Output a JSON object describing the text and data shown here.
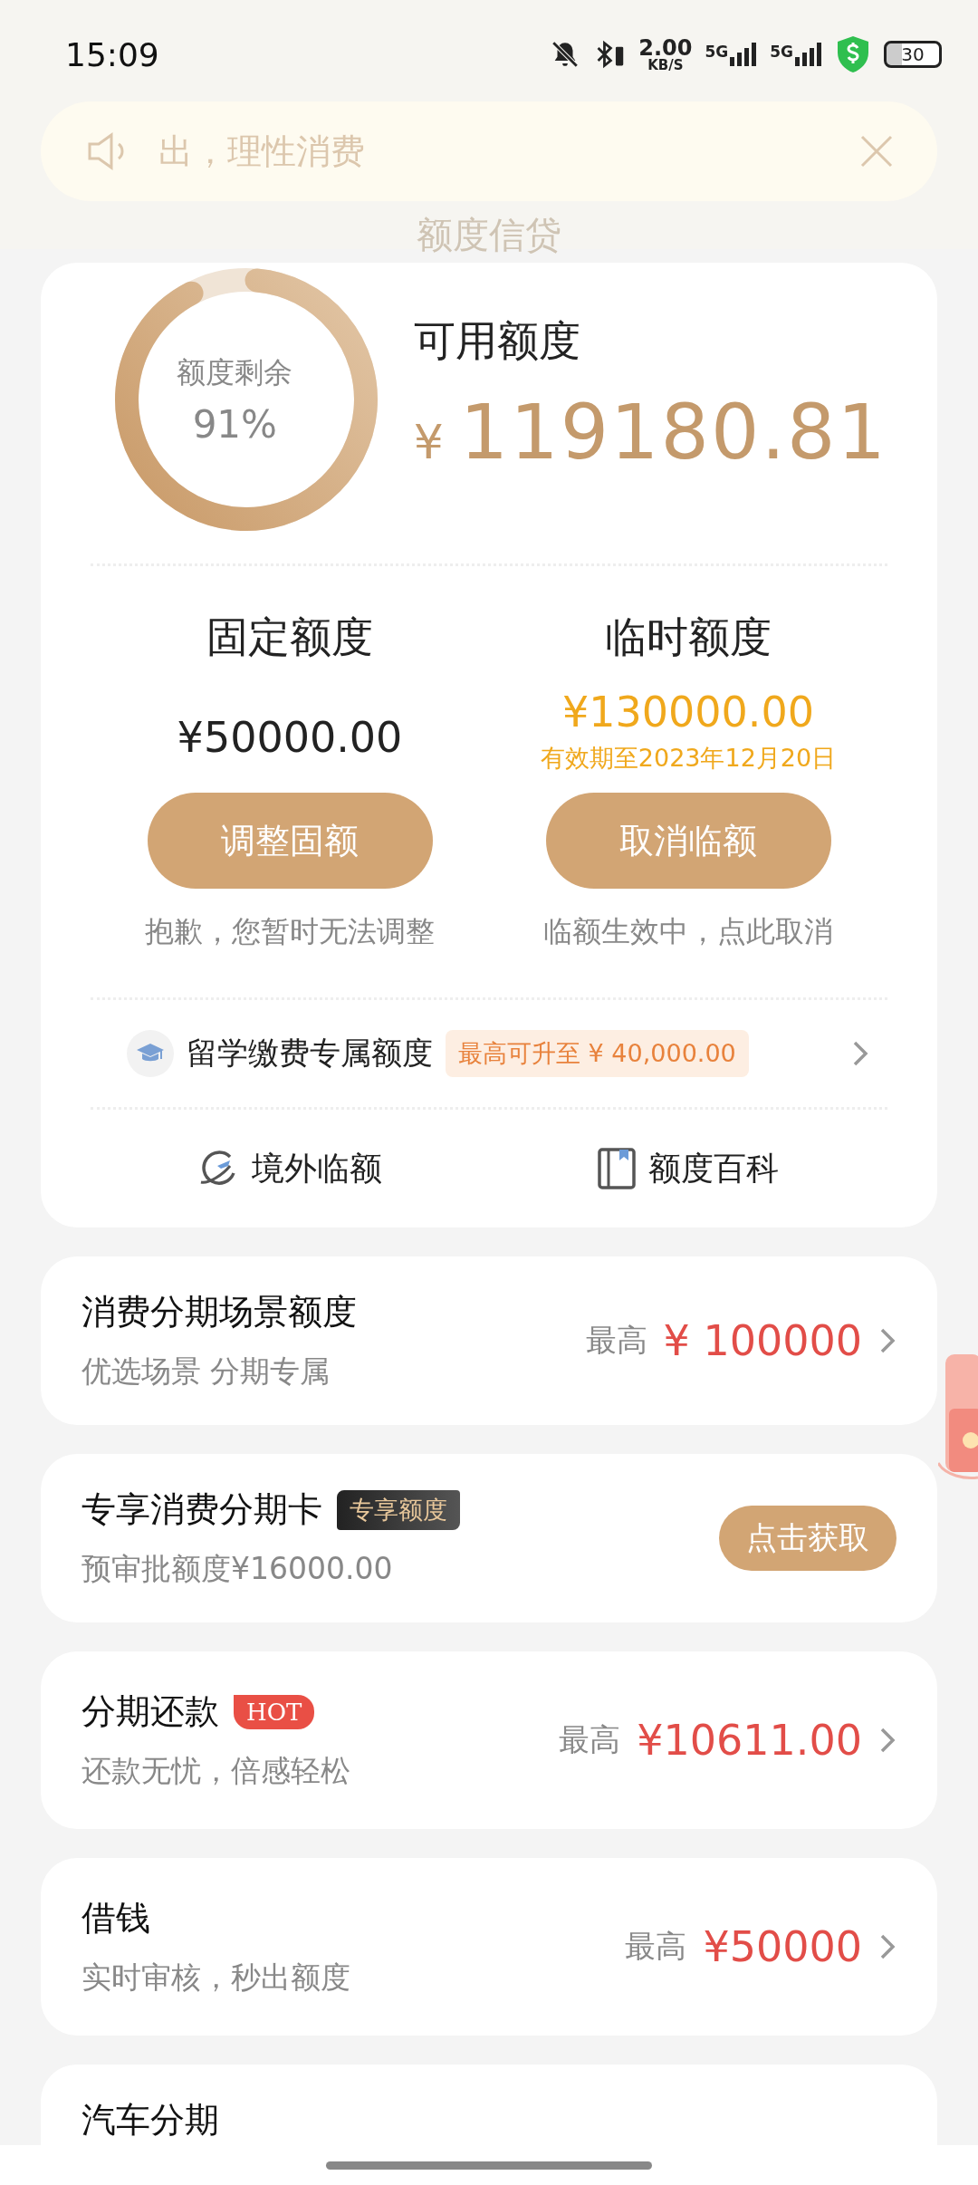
{
  "status_bar": {
    "time": "15:09",
    "net_speed": "2.00",
    "net_unit": "KB/S",
    "network_1": "5G",
    "network_2": "5G",
    "battery": "30"
  },
  "header": {
    "title": "额度信贷"
  },
  "notice": {
    "text": "出，理性消费"
  },
  "credit": {
    "ring_label": "额度剩余",
    "ring_percent": "91%",
    "level": 0.91,
    "available_label": "可用额度",
    "currency": "¥",
    "available_amount": "119180.81"
  },
  "limits": [
    {
      "kind": "fixed",
      "title": "固定额度",
      "amount": "¥50000.00",
      "button": "调整固额",
      "note": "抱歉，您暂时无法调整"
    },
    {
      "kind": "temporary",
      "title": "临时额度",
      "amount": "¥130000.00",
      "validity": "有效期至2023年12月20日",
      "button": "取消临额",
      "note": "临额生效中，点此取消"
    }
  ],
  "study_row": {
    "label": "留学缴费专属额度",
    "tag": "最高可升至 ¥ 40,000.00"
  },
  "shortcuts": [
    {
      "label": "境外临额"
    },
    {
      "label": "额度百科"
    }
  ],
  "products": [
    {
      "kind": "max",
      "title": "消费分期场景额度",
      "subtitle": "优选场景 分期专属",
      "prefix": "最高",
      "amount": "¥ 100000"
    },
    {
      "kind": "action",
      "title": "专享消费分期卡",
      "badge": {
        "kind": "dark",
        "text": "专享额度"
      },
      "subtitle": "预审批额度¥16000.00",
      "button": "点击获取"
    },
    {
      "kind": "max",
      "title": "分期还款",
      "badge": {
        "kind": "hot",
        "text": "HOT"
      },
      "subtitle": "还款无忧，倍感轻松",
      "prefix": "最高",
      "amount": "¥10611.00"
    },
    {
      "kind": "max",
      "title": "借钱",
      "subtitle": "实时审核，秒出额度",
      "prefix": "最高",
      "amount": "¥50000"
    },
    {
      "kind": "plain",
      "title": "汽车分期"
    }
  ]
}
